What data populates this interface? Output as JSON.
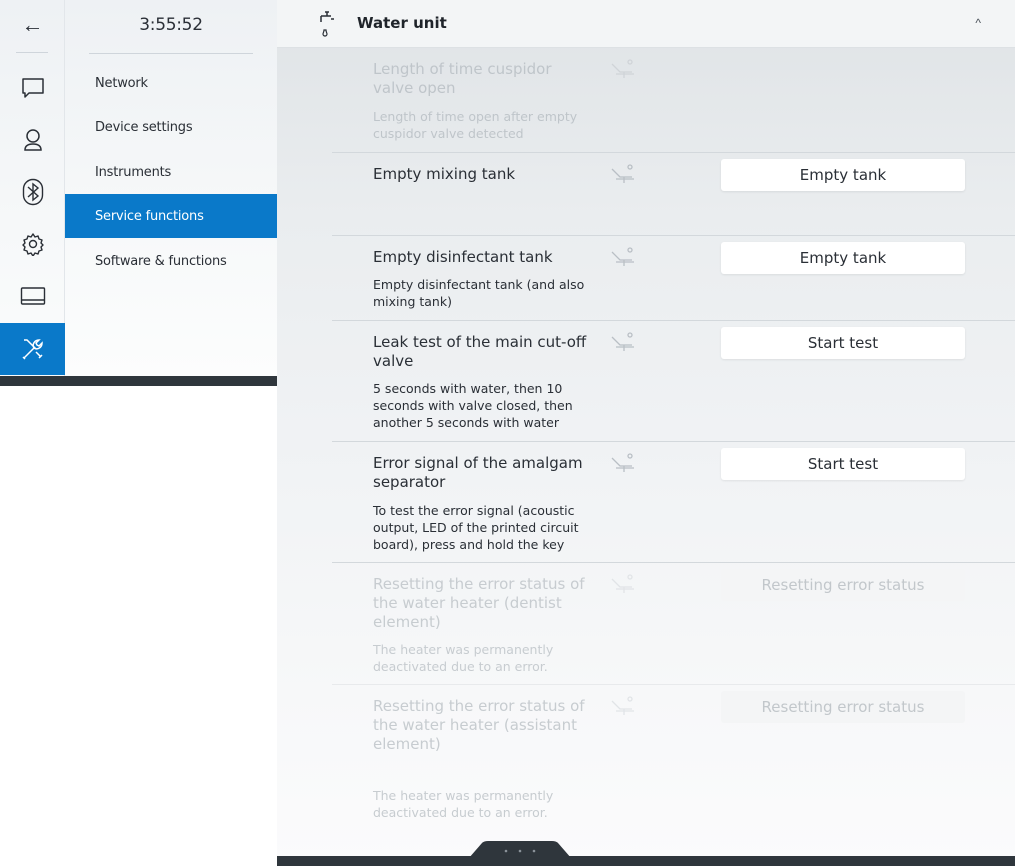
{
  "nav": {
    "back_icon": "arrow-left-icon",
    "rail_icons": [
      "chat-icon",
      "user-icon",
      "bluetooth-icon",
      "gear-icon",
      "display-icon",
      "tools-icon"
    ],
    "active_rail": "tools-icon",
    "active_color": "#0a79c9"
  },
  "clock": "3:55:52",
  "menu": {
    "items": [
      {
        "label": "Network"
      },
      {
        "label": "Device settings"
      },
      {
        "label": "Instruments"
      },
      {
        "label": "Service functions"
      },
      {
        "label": "Software & functions"
      }
    ],
    "active_index": 3
  },
  "section": {
    "title": "Water unit",
    "icon": "water-tap-icon",
    "expanded_icon": "chevron-up-icon"
  },
  "rows": [
    {
      "title": "Length of time cuspidor valve open",
      "desc": "Length of time open after empty cuspidor valve detected",
      "button": ""
    },
    {
      "title": "Empty mixing tank",
      "desc": "",
      "button": "Empty tank"
    },
    {
      "title": "Empty disinfectant tank",
      "desc": "Empty disinfectant tank (and also mixing tank)",
      "button": "Empty tank"
    },
    {
      "title": "Leak test of the main cut-off valve",
      "desc": "5 seconds with water, then 10 seconds with valve closed, then another 5 seconds with water",
      "button": "Start test"
    },
    {
      "title": "Error signal of the amalgam separator",
      "desc": "To test the error signal (acoustic output, LED of the printed circuit board), press and hold the key",
      "button": "Start test"
    },
    {
      "title": "Resetting the error status of the water heater (dentist element)",
      "desc": "The heater was permanently deactivated due to an error.",
      "button": "Resetting error status"
    },
    {
      "title": "Resetting the error status of the water heater (assistant element)",
      "desc": "The heater was permanently deactivated due to an error.",
      "button": "Resetting error status"
    }
  ],
  "row_icon": "dental-chair-icon"
}
